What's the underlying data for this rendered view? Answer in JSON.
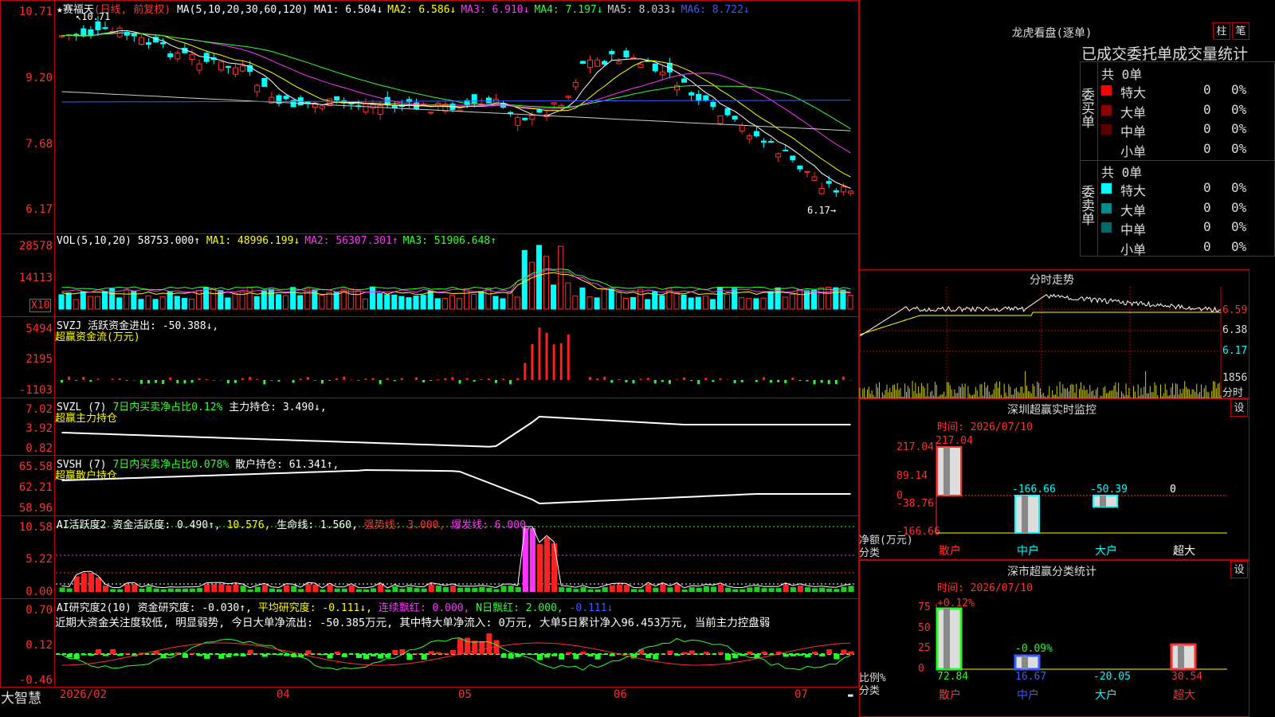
{
  "stock": {
    "title": "★赛福天",
    "mode": "(日线, 前复权)",
    "ma_header": "MA(5,10,20,30,60,120)",
    "ma": [
      {
        "label": "MA1:",
        "value": "6.504↓",
        "color": "#ffffff"
      },
      {
        "label": "MA2:",
        "value": "6.586↓",
        "color": "#ffff00"
      },
      {
        "label": "MA3:",
        "value": "6.910↓",
        "color": "#ff33ff"
      },
      {
        "label": "MA4:",
        "value": "7.197↓",
        "color": "#33ff33"
      },
      {
        "label": "MA5:",
        "value": "8.033↓",
        "color": "#cccccc"
      },
      {
        "label": "MA6:",
        "value": "8.722↓",
        "color": "#3a5cff"
      }
    ],
    "price_axis": [
      "10.71",
      "9.20",
      "7.68",
      "6.17"
    ],
    "high_mark": "10.71",
    "low_mark": "6.17→"
  },
  "volume": {
    "header": "VOL(5,10,20)",
    "value": "58753.000↑",
    "ma": [
      {
        "label": "MA1:",
        "value": "48996.199↓",
        "color": "#ffff00"
      },
      {
        "label": "MA2:",
        "value": "56307.301↑",
        "color": "#ff33ff"
      },
      {
        "label": "MA3:",
        "value": "51906.648↑",
        "color": "#33ff33"
      }
    ],
    "axis": [
      "28578",
      "14113"
    ],
    "unit": "X10"
  },
  "svzj": {
    "header": "SVZJ",
    "label": "活跃资金进出:",
    "value": "-50.388↓,",
    "subtitle": "超赢资金流(万元)",
    "axis": [
      "5494",
      "2195",
      "-1103"
    ]
  },
  "svzl": {
    "header": "SVZL (7)",
    "ratio": "7日内买卖净占比0.12%",
    "label": "主力持仓:",
    "value": "3.490↓,",
    "subtitle": "超赢主力持仓",
    "axis": [
      "7.02",
      "3.92",
      "0.82"
    ]
  },
  "svsh": {
    "header": "SVSH (7)",
    "ratio": "7日内买卖净占比0.078%",
    "label": "散户持仓:",
    "value": "61.341↑,",
    "subtitle": "超赢散户持仓",
    "axis": [
      "65.58",
      "62.21",
      "58.96"
    ]
  },
  "ai_active": {
    "header": "AI活跃度2",
    "label": "资金活跃度:",
    "value": "0.490↑,",
    "v2": "10.576,",
    "life": "生命线: 1.560,",
    "strong": "强势线: 3.000,",
    "burst": "爆发线: 6.000,",
    "axis": [
      "10.58",
      "5.22",
      "0.00"
    ]
  },
  "ai_research": {
    "header": "AI研究度2(10)",
    "label": "资金研究度:",
    "value": "-0.030↑,",
    "avg": "平均研究度: -0.111↓,",
    "cont": "连续飘红: 0.000,",
    "nday": "N日飘红: 2.000,",
    "last": "-0.111↓",
    "comment": "近期大资金关注度较低, 明显弱势, 今日大单净流出: -50.385万元, 其中特大单净流入: 0万元, 大单5日累计净入96.453万元, 当前主力控盘弱",
    "axis": [
      "0.70",
      "0.12",
      "-0.46"
    ]
  },
  "date_axis": [
    "2026/02",
    "04",
    "05",
    "06",
    "07"
  ],
  "brand": "大智慧",
  "dragon": {
    "title": "龙虎看盘(逐单)",
    "btn_bar": "柱",
    "btn_pen": "笔",
    "header": "已成交委托单成交量统计",
    "buy_label": "委买单",
    "sell_label": "委卖单",
    "buy_total": "共 0单",
    "sell_total": "共 0单",
    "buy_rows": [
      {
        "name": "特大",
        "count": "0",
        "pct": "0%",
        "color": "#ff0000"
      },
      {
        "name": "大单",
        "count": "0",
        "pct": "0%",
        "color": "#8b0000"
      },
      {
        "name": "中单",
        "count": "0",
        "pct": "0%",
        "color": "#5a0000"
      },
      {
        "name": "小单",
        "count": "0",
        "pct": "0%",
        "color": "#000000"
      }
    ],
    "sell_rows": [
      {
        "name": "特大",
        "count": "0",
        "pct": "0%",
        "color": "#00ffff"
      },
      {
        "name": "大单",
        "count": "0",
        "pct": "0%",
        "color": "#008b8b"
      },
      {
        "name": "中单",
        "count": "0",
        "pct": "0%",
        "color": "#006a6a"
      },
      {
        "name": "小单",
        "count": "0",
        "pct": "0%",
        "color": "#000000"
      }
    ]
  },
  "intraday": {
    "title": "分时走势",
    "axis": [
      "6.59",
      "6.38",
      "6.17"
    ],
    "vol_label": "1856",
    "vol_unit": "分时"
  },
  "sz_monitor": {
    "title": "深圳超赢实时监控",
    "btn": "设",
    "time": "时间: 2026/07/10",
    "axis": [
      "217.04",
      "89.14",
      "0",
      "-38.76",
      "-166.66"
    ],
    "ylabel": "净额(万元)",
    "xlabel": "分类",
    "bars": [
      {
        "cat": "散户",
        "value": "217.04"
      },
      {
        "cat": "中户",
        "value": "-166.66"
      },
      {
        "cat": "大户",
        "value": "-50.39"
      },
      {
        "cat": "超大",
        "value": "0"
      }
    ]
  },
  "sz_class": {
    "title": "深市超赢分类统计",
    "btn": "设",
    "time": "时间: 2026/07/10",
    "axis": [
      "75",
      "50",
      "25",
      "0"
    ],
    "ylabel": "比例%",
    "xlabel": "分类",
    "top_labels": [
      "+0.12%",
      "-0.09%"
    ],
    "bars": [
      {
        "cat": "散户",
        "value": "72.84"
      },
      {
        "cat": "中户",
        "value": "16.67"
      },
      {
        "cat": "大户",
        "value": "-20.05"
      },
      {
        "cat": "超大",
        "value": "30.54"
      }
    ]
  },
  "colors": {
    "up": "#ff3030",
    "down": "#00ffff",
    "grid": "#c00000"
  }
}
